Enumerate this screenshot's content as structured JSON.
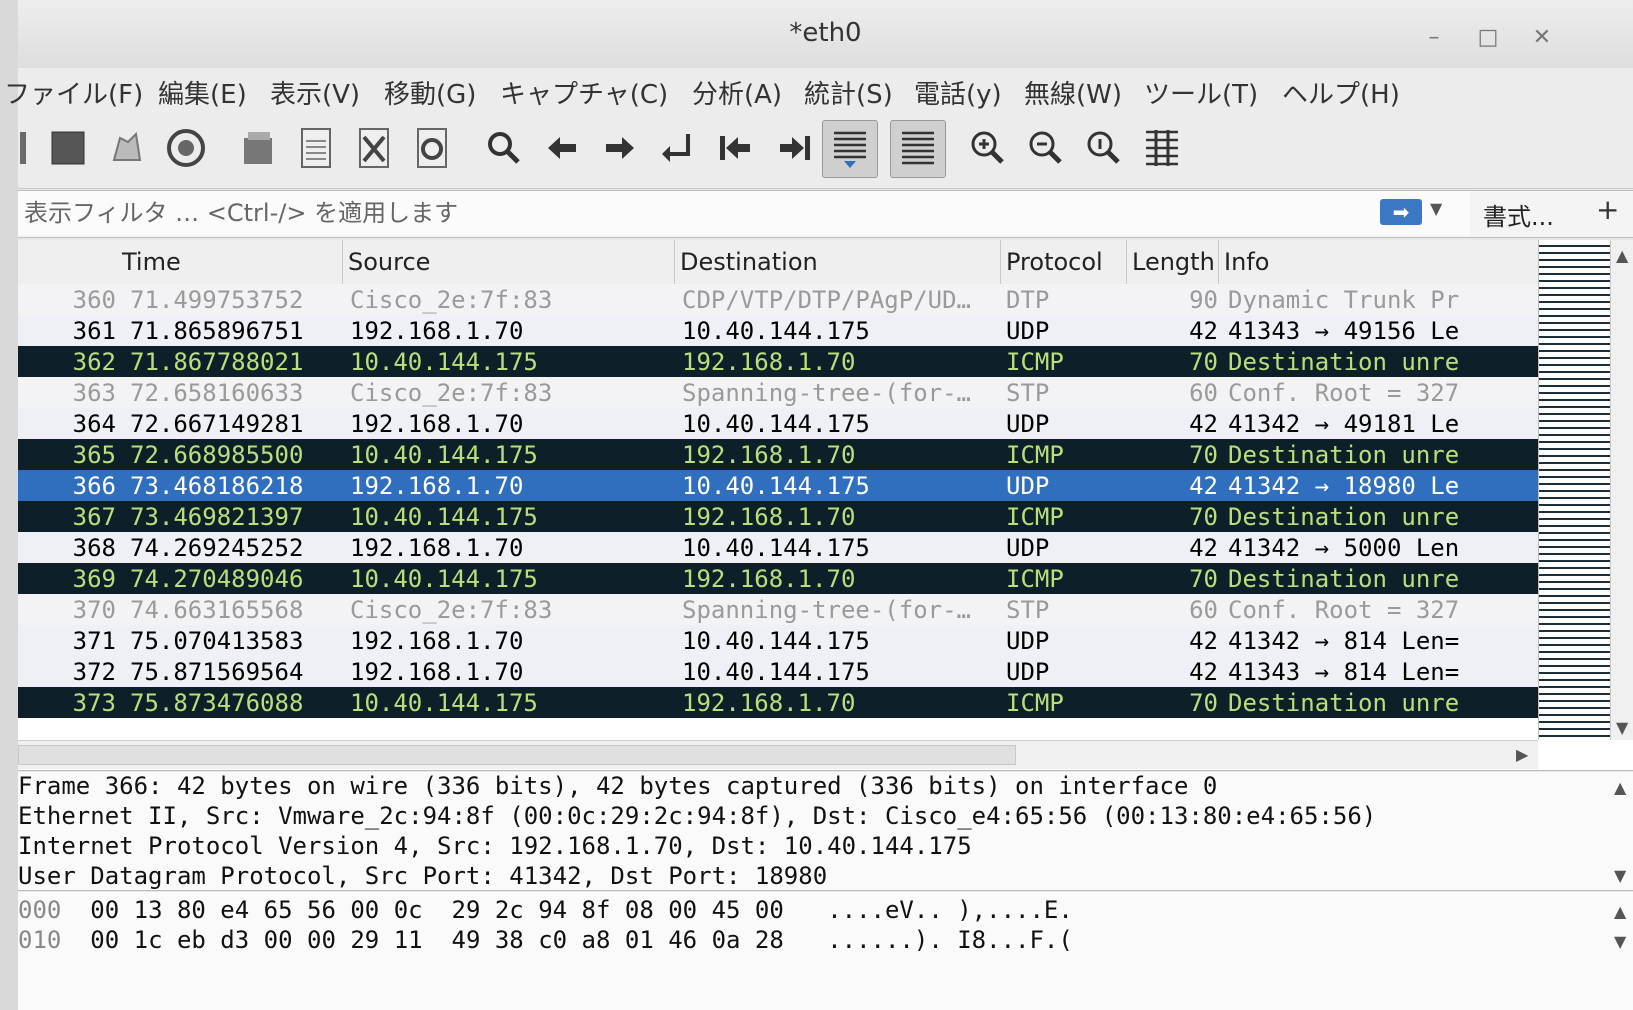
{
  "window": {
    "title": "*eth0"
  },
  "menu": [
    "ファイル(F)",
    "編集(E)",
    "表示(V)",
    "移動(G)",
    "キャプチャ(C)",
    "分析(A)",
    "統計(S)",
    "電話(y)",
    "無線(W)",
    "ツール(T)",
    "ヘルプ(H)"
  ],
  "filter": {
    "placeholder": "表示フィルタ … <Ctrl-/> を適用します",
    "apply": "➡",
    "format_label": "書式...",
    "add_label": "+"
  },
  "columns": {
    "time": "Time",
    "source": "Source",
    "destination": "Destination",
    "protocol": "Protocol",
    "length": "Length",
    "info": "Info"
  },
  "packets": [
    {
      "no": "360",
      "time": "71.499753752",
      "src": "Cisco_2e:7f:83",
      "dst": "CDP/VTP/DTP/PAgP/UD…",
      "proto": "DTP",
      "len": "90",
      "info": "Dynamic Trunk Pr",
      "style": "dtp"
    },
    {
      "no": "361",
      "time": "71.865896751",
      "src": "192.168.1.70",
      "dst": "10.40.144.175",
      "proto": "UDP",
      "len": "42",
      "info": "41343 → 49156 Le",
      "style": "light"
    },
    {
      "no": "362",
      "time": "71.867788021",
      "src": "10.40.144.175",
      "dst": "192.168.1.70",
      "proto": "ICMP",
      "len": "70",
      "info": "Destination unre",
      "style": "icmp"
    },
    {
      "no": "363",
      "time": "72.658160633",
      "src": "Cisco_2e:7f:83",
      "dst": "Spanning-tree-(for-…",
      "proto": "STP",
      "len": "60",
      "info": "Conf. Root = 327",
      "style": "dtp"
    },
    {
      "no": "364",
      "time": "72.667149281",
      "src": "192.168.1.70",
      "dst": "10.40.144.175",
      "proto": "UDP",
      "len": "42",
      "info": "41342 → 49181 Le",
      "style": "light"
    },
    {
      "no": "365",
      "time": "72.668985500",
      "src": "10.40.144.175",
      "dst": "192.168.1.70",
      "proto": "ICMP",
      "len": "70",
      "info": "Destination unre",
      "style": "icmp"
    },
    {
      "no": "366",
      "time": "73.468186218",
      "src": "192.168.1.70",
      "dst": "10.40.144.175",
      "proto": "UDP",
      "len": "42",
      "info": "41342 → 18980 Le",
      "style": "sel"
    },
    {
      "no": "367",
      "time": "73.469821397",
      "src": "10.40.144.175",
      "dst": "192.168.1.70",
      "proto": "ICMP",
      "len": "70",
      "info": "Destination unre",
      "style": "icmp"
    },
    {
      "no": "368",
      "time": "74.269245252",
      "src": "192.168.1.70",
      "dst": "10.40.144.175",
      "proto": "UDP",
      "len": "42",
      "info": "41342 → 5000 Len",
      "style": "light"
    },
    {
      "no": "369",
      "time": "74.270489046",
      "src": "10.40.144.175",
      "dst": "192.168.1.70",
      "proto": "ICMP",
      "len": "70",
      "info": "Destination unre",
      "style": "icmp"
    },
    {
      "no": "370",
      "time": "74.663165568",
      "src": "Cisco_2e:7f:83",
      "dst": "Spanning-tree-(for-…",
      "proto": "STP",
      "len": "60",
      "info": "Conf. Root = 327",
      "style": "dtp"
    },
    {
      "no": "371",
      "time": "75.070413583",
      "src": "192.168.1.70",
      "dst": "10.40.144.175",
      "proto": "UDP",
      "len": "42",
      "info": "41342 → 814 Len=",
      "style": "light"
    },
    {
      "no": "372",
      "time": "75.871569564",
      "src": "192.168.1.70",
      "dst": "10.40.144.175",
      "proto": "UDP",
      "len": "42",
      "info": "41343 → 814 Len=",
      "style": "light"
    },
    {
      "no": "373",
      "time": "75.873476088",
      "src": "10.40.144.175",
      "dst": "192.168.1.70",
      "proto": "ICMP",
      "len": "70",
      "info": "Destination unre",
      "style": "icmp"
    }
  ],
  "details": [
    "Frame 366: 42 bytes on wire (336 bits), 42 bytes captured (336 bits) on interface 0",
    "Ethernet II, Src: Vmware_2c:94:8f (00:0c:29:2c:94:8f), Dst: Cisco_e4:65:56 (00:13:80:e4:65:56)",
    "Internet Protocol Version 4, Src: 192.168.1.70, Dst: 10.40.144.175",
    "User Datagram Protocol, Src Port: 41342, Dst Port: 18980"
  ],
  "bytes": [
    {
      "offset": "000",
      "hex": "00 13 80 e4 65 56 00 0c  29 2c 94 8f 08 00 45 00",
      "ascii": "....eV.. ),....E."
    },
    {
      "offset": "010",
      "hex": "00 1c eb d3 00 00 29 11  49 38 c0 a8 01 46 0a 28",
      "ascii": "......). I8...F.("
    }
  ]
}
